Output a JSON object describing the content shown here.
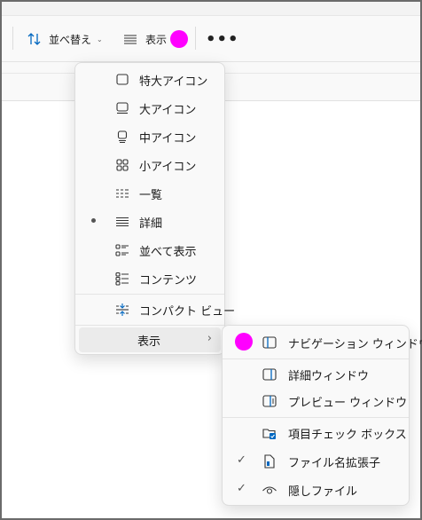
{
  "toolbar": {
    "sort_label": "並べ替え",
    "view_label": "表示",
    "more_label": "•••"
  },
  "view_menu": {
    "items": [
      {
        "label": "特大アイコン",
        "icon": "extra-large-icons-icon",
        "selected": false
      },
      {
        "label": "大アイコン",
        "icon": "large-icons-icon",
        "selected": false
      },
      {
        "label": "中アイコン",
        "icon": "medium-icons-icon",
        "selected": false
      },
      {
        "label": "小アイコン",
        "icon": "small-icons-icon",
        "selected": false
      },
      {
        "label": "一覧",
        "icon": "list-icon",
        "selected": false
      },
      {
        "label": "詳細",
        "icon": "details-icon",
        "selected": true
      },
      {
        "label": "並べて表示",
        "icon": "tiles-icon",
        "selected": false
      },
      {
        "label": "コンテンツ",
        "icon": "content-icon",
        "selected": false
      }
    ],
    "compact_label": "コンパクト ビュー",
    "show_label": "表示"
  },
  "show_submenu": {
    "items": [
      {
        "label": "ナビゲーション ウィンドウ",
        "icon": "navigation-pane-icon",
        "checked": false
      },
      {
        "label": "詳細ウィンドウ",
        "icon": "details-pane-icon",
        "checked": false
      },
      {
        "label": "プレビュー ウィンドウ",
        "icon": "preview-pane-icon",
        "checked": false
      },
      {
        "label": "項目チェック ボックス",
        "icon": "item-checkbox-icon",
        "checked": false
      },
      {
        "label": "ファイル名拡張子",
        "icon": "file-extension-icon",
        "checked": true
      },
      {
        "label": "隠しファイル",
        "icon": "hidden-files-icon",
        "checked": true
      }
    ]
  },
  "colors": {
    "accent": "#0067c0",
    "highlight_marker": "#ff00ff"
  }
}
